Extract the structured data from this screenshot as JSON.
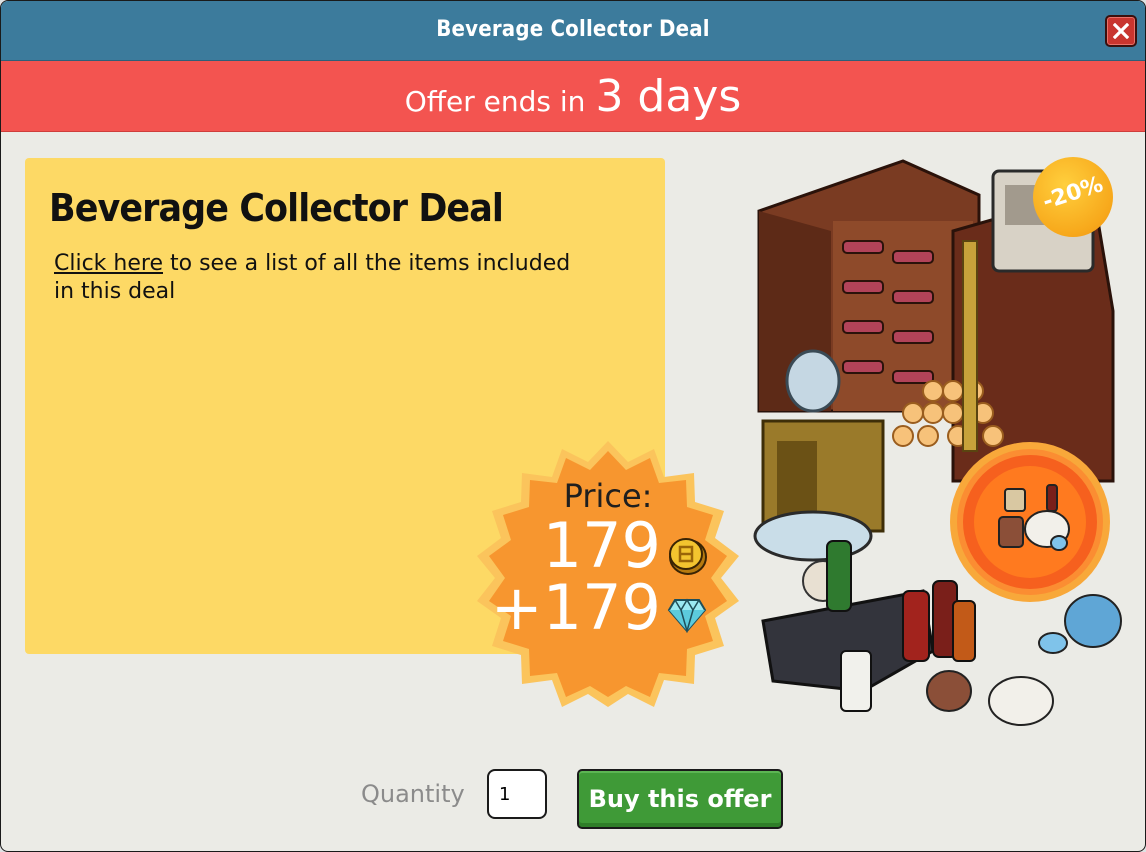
{
  "window": {
    "title": "Beverage Collector Deal",
    "close_icon": "close-icon"
  },
  "offer": {
    "prefix": "Offer ends in",
    "value": "3 days"
  },
  "deal": {
    "title": "Beverage Collector Deal",
    "link_text": "Click here",
    "description_rest": " to see a list of all the items included in this deal"
  },
  "price": {
    "label": "Price:",
    "credits": "179",
    "diamonds": "+179",
    "credit_icon": "coin-icon",
    "diamond_icon": "diamond-icon"
  },
  "discount": {
    "text": "-20%"
  },
  "footer": {
    "quantity_label": "Quantity",
    "quantity_value": "1",
    "buy_label": "Buy this offer"
  },
  "colors": {
    "titlebar": "#3c7b9c",
    "banner": "#f35450",
    "panel": "#fdd965",
    "badge": "#f7962f",
    "buy_button": "#3f9a37",
    "close_button": "#c8352f"
  }
}
